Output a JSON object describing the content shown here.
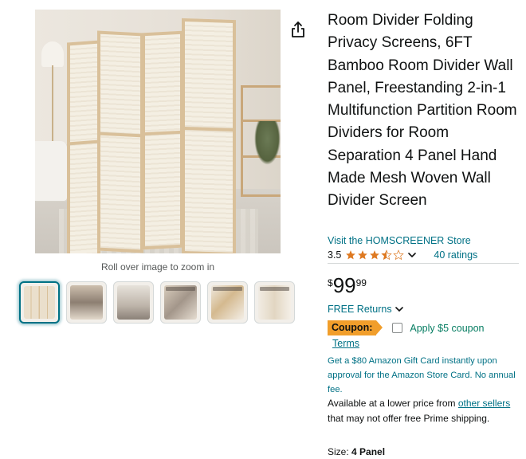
{
  "gallery": {
    "zoom_hint": "Roll over image to zoom in",
    "thumbnails": [
      {
        "alt": "Bamboo folding room divider",
        "active": true
      },
      {
        "alt": "Room divider in living room",
        "active": false
      },
      {
        "alt": "Room divider beside window",
        "active": false
      },
      {
        "alt": "Room divider feature detail",
        "active": false
      },
      {
        "alt": "Room divider size chart",
        "active": false
      },
      {
        "alt": "Room divider panel view",
        "active": false
      }
    ]
  },
  "product": {
    "title": "Room Divider Folding Privacy Screens, 6FT Bamboo Room Divider Wall Panel, Freestanding 2-in-1 Multifunction Partition Room Dividers for Room Separation 4 Panel Hand Made Mesh Woven Wall Divider Screen",
    "store_link": "Visit the HOMSCREENER Store",
    "rating": "3.5",
    "rating_value": 3.5,
    "ratings_count": "40 ratings",
    "price_symbol": "$",
    "price_whole": "99",
    "price_fraction": "99",
    "returns": "FREE Returns",
    "coupon_badge": "Coupon:",
    "coupon_apply": "Apply $5 coupon",
    "coupon_terms": "Terms",
    "giftcard_offer": "Get a $80 Amazon Gift Card instantly upon approval for the Amazon Store Card. No annual fee.",
    "lower_price_prefix": "Available at a lower price from",
    "lower_price_link": "other sellers",
    "lower_price_suffix": "that may not offer free Prime shipping.",
    "size_label": "Size:",
    "size_value": "4 Panel"
  },
  "colors": {
    "link": "#007185",
    "coupon": "#f19e2b",
    "star": "#de7921",
    "apply": "#067d62"
  }
}
